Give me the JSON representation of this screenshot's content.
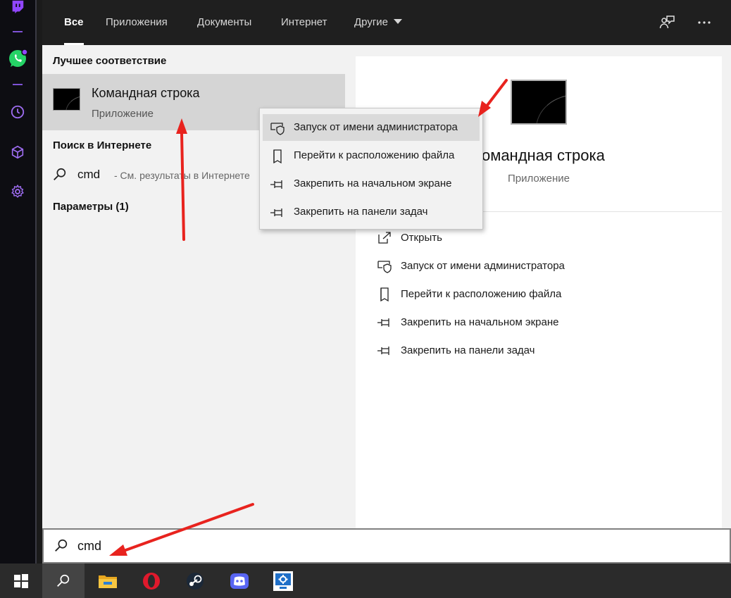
{
  "tabs": [
    {
      "label": "Все"
    },
    {
      "label": "Приложения"
    },
    {
      "label": "Документы"
    },
    {
      "label": "Интернет"
    },
    {
      "label": "Другие"
    }
  ],
  "toolbar": {
    "feedback_icon": "feedback-icon",
    "more_icon": "more-icon"
  },
  "results": {
    "best_match_header": "Лучшее соответствие",
    "best_match": {
      "title": "Командная строка",
      "subtitle": "Приложение"
    },
    "web_header": "Поиск в Интернете",
    "web_query": "cmd",
    "web_hint": "- См. результаты в Интернете",
    "settings_header": "Параметры (1)"
  },
  "preview": {
    "title": "Командная строка",
    "subtitle": "Приложение",
    "actions": [
      {
        "label": "Открыть",
        "icon": "open-icon"
      },
      {
        "label": "Запуск от имени администратора",
        "icon": "shield-icon"
      },
      {
        "label": "Перейти к расположению файла",
        "icon": "file-location-icon"
      },
      {
        "label": "Закрепить на начальном экране",
        "icon": "pin-icon"
      },
      {
        "label": "Закрепить на панели задач",
        "icon": "pin-icon"
      }
    ]
  },
  "context_menu": [
    {
      "label": "Запуск от имени администратора",
      "icon": "shield-icon",
      "highlighted": true
    },
    {
      "label": "Перейти к расположению файла",
      "icon": "file-location-icon"
    },
    {
      "label": "Закрепить на начальном экране",
      "icon": "pin-icon"
    },
    {
      "label": "Закрепить на панели задач",
      "icon": "pin-icon"
    }
  ],
  "search": {
    "value": "cmd"
  },
  "taskbar": [
    "windows-start-icon",
    "search-icon",
    "file-explorer-icon",
    "opera-icon",
    "steam-icon",
    "discord-icon",
    "remote-desktop-icon"
  ],
  "colors": {
    "annotation_arrow": "#e8231e",
    "rail_accent": "#9146ff",
    "whatsapp": "#25d366"
  }
}
